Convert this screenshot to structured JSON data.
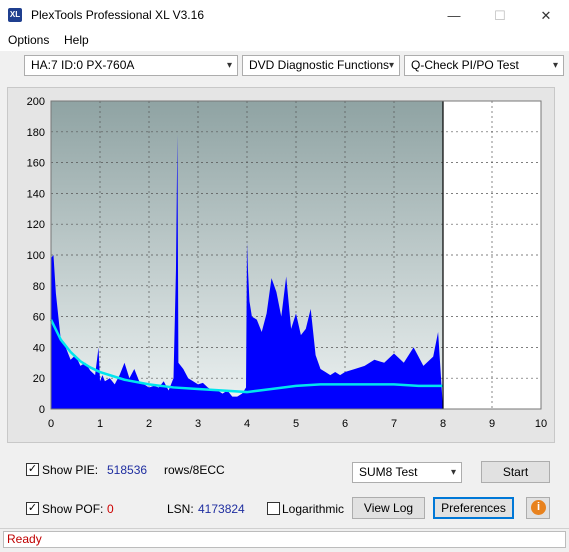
{
  "window": {
    "title": "PlexTools Professional XL V3.16",
    "app_icon": "XL",
    "minimize_glyph": "—",
    "maximize_glyph": "☐",
    "close_glyph": "✕"
  },
  "menu": [
    {
      "label": "Options",
      "mnemonic": "O"
    },
    {
      "label": "Help",
      "mnemonic": "H"
    }
  ],
  "selectors": {
    "drive": "HA:7 ID:0  PX-760A",
    "function": "DVD Diagnostic Functions",
    "test": "Q-Check PI/PO Test",
    "arrow": "▾"
  },
  "chart_data": {
    "type": "area",
    "xlim": [
      0,
      10
    ],
    "ylim": [
      0,
      200
    ],
    "x_ticks": [
      "0",
      "1",
      "2",
      "3",
      "4",
      "5",
      "6",
      "7",
      "8",
      "9",
      "10"
    ],
    "y_ticks": [
      "200",
      "180",
      "160",
      "140",
      "120",
      "100",
      "80",
      "60",
      "40",
      "20",
      "0"
    ],
    "grid": true,
    "scan_end_x": 8,
    "colors": {
      "pie": "#0000ff",
      "sum8": "#00e5ee",
      "plot_bg_top": "#8fa3a3",
      "plot_bg_bottom": "#edf2f2"
    },
    "series": [
      {
        "kind": "pie",
        "x": [
          0,
          0.05,
          0.1,
          0.15,
          0.2,
          0.3,
          0.4,
          0.5,
          0.6,
          0.7,
          0.8,
          0.9,
          0.97,
          1.0,
          1.05,
          1.1,
          1.2,
          1.3,
          1.4,
          1.5,
          1.6,
          1.7,
          1.8,
          1.9,
          2.0,
          2.1,
          2.2,
          2.3,
          2.4,
          2.5,
          2.55,
          2.58,
          2.6,
          2.65,
          2.7,
          2.8,
          2.9,
          3.0,
          3.1,
          3.2,
          3.3,
          3.4,
          3.5,
          3.6,
          3.7,
          3.8,
          3.9,
          3.98,
          4.0,
          4.02,
          4.05,
          4.1,
          4.2,
          4.3,
          4.4,
          4.5,
          4.6,
          4.7,
          4.8,
          4.9,
          5.0,
          5.1,
          5.2,
          5.3,
          5.4,
          5.5,
          5.6,
          5.7,
          5.8,
          5.9,
          6.0,
          6.2,
          6.4,
          6.6,
          6.8,
          7.0,
          7.2,
          7.4,
          7.6,
          7.8,
          7.9,
          8.0
        ],
        "y": [
          98,
          100,
          75,
          60,
          45,
          40,
          32,
          35,
          28,
          30,
          25,
          22,
          40,
          18,
          22,
          18,
          20,
          16,
          22,
          30,
          20,
          26,
          18,
          16,
          14,
          15,
          14,
          18,
          12,
          20,
          90,
          178,
          30,
          28,
          26,
          20,
          18,
          16,
          17,
          14,
          12,
          12,
          10,
          12,
          8,
          8,
          10,
          14,
          108,
          90,
          70,
          60,
          58,
          50,
          62,
          85,
          76,
          60,
          86,
          52,
          62,
          48,
          52,
          65,
          35,
          26,
          24,
          22,
          24,
          22,
          24,
          26,
          28,
          32,
          30,
          36,
          30,
          40,
          28,
          34,
          50,
          0
        ]
      },
      {
        "kind": "sum8",
        "x": [
          0,
          0.2,
          0.4,
          0.6,
          0.8,
          1.0,
          1.5,
          2.0,
          2.5,
          3.0,
          3.5,
          4.0,
          4.5,
          5.0,
          5.5,
          6.0,
          6.5,
          7.0,
          7.5,
          8.0
        ],
        "y": [
          58,
          45,
          37,
          31,
          27,
          24,
          19,
          16,
          14,
          13,
          12,
          11,
          13,
          15,
          16,
          16,
          16,
          16,
          15,
          15
        ]
      }
    ]
  },
  "controls": {
    "show_pie_label": "Show PIE:",
    "show_pie_mnemonic": "I",
    "show_pie_checked": true,
    "pie_value": "518536",
    "rows_label": "rows/8ECC",
    "show_pof_label": "Show POF:",
    "show_pof_mnemonic": "F",
    "show_pof_checked": true,
    "pof_value": "0",
    "lsn_label": "LSN:",
    "lsn_value": "4173824",
    "logarithmic_label": "Logarithmic",
    "logarithmic_checked": false,
    "test_mode": "SUM8 Test",
    "start_label": "Start",
    "view_log_label": "View Log",
    "preferences_label": "Preferences",
    "check_mark": "✓",
    "info_glyph": "i"
  },
  "status": {
    "text": "Ready"
  }
}
